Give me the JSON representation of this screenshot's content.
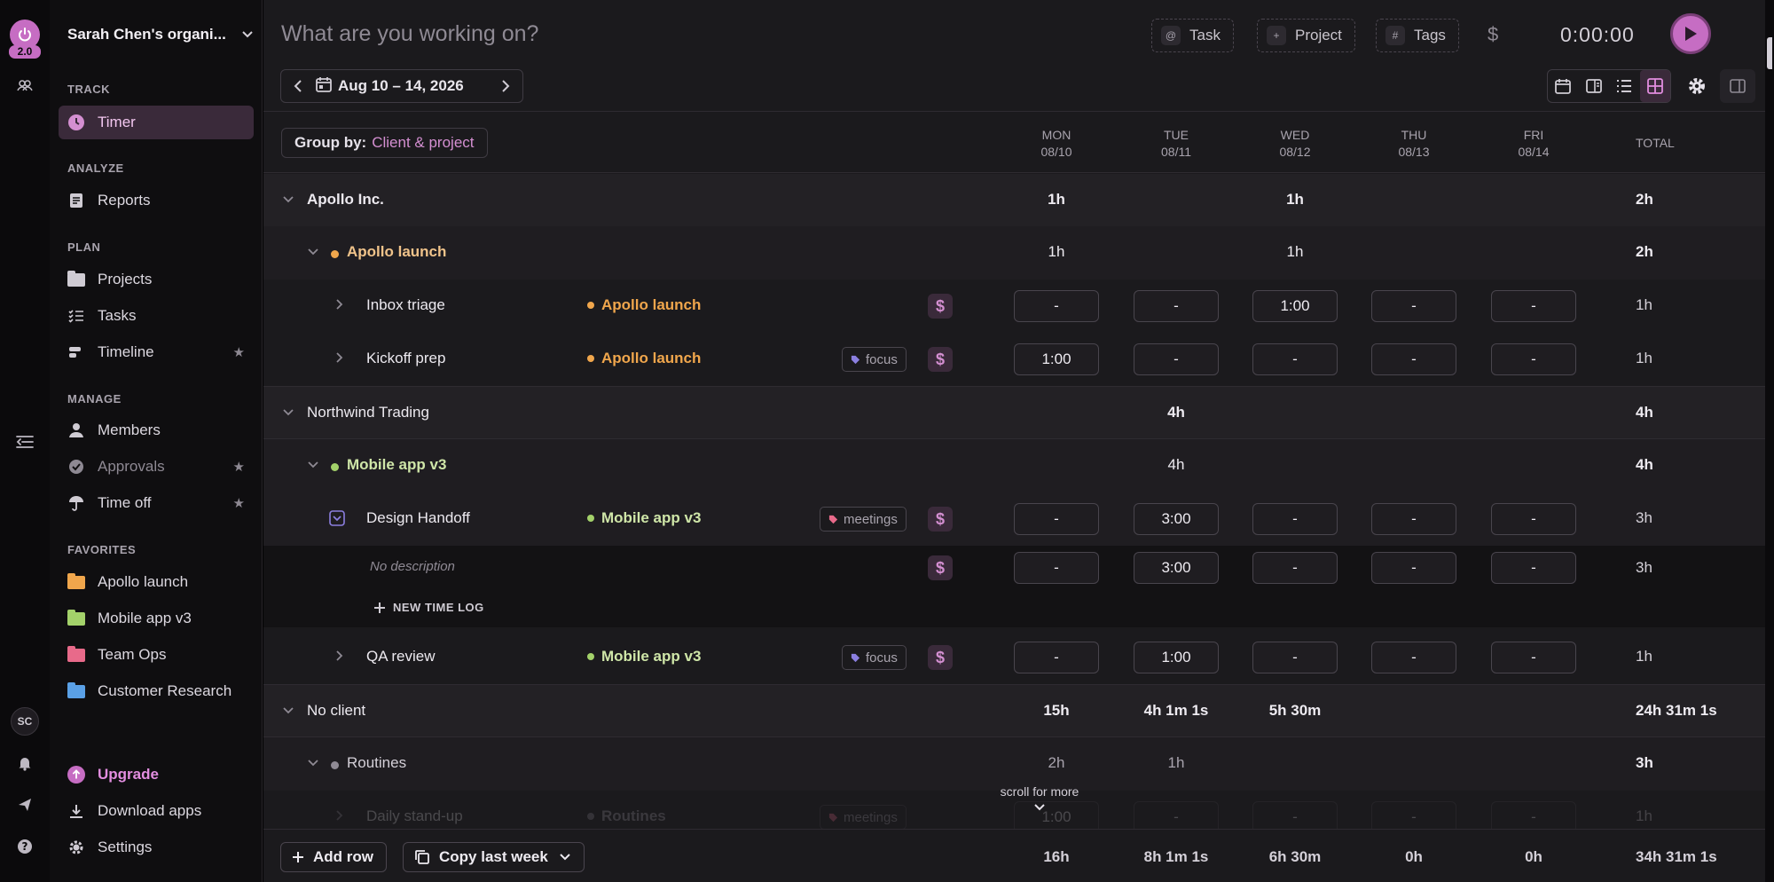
{
  "rail": {
    "version": "2.0",
    "avatar": "SC"
  },
  "sidebar": {
    "org_name": "Sarah Chen's organi...",
    "sections": {
      "track": "TRACK",
      "analyze": "ANALYZE",
      "plan": "PLAN",
      "manage": "MANAGE",
      "favorites": "FAVORITES"
    },
    "items": {
      "timer": "Timer",
      "reports": "Reports",
      "projects": "Projects",
      "tasks": "Tasks",
      "timeline": "Timeline",
      "members": "Members",
      "approvals": "Approvals",
      "time_off": "Time off"
    },
    "favorites": [
      {
        "label": "Apollo launch",
        "color": "#f0a64c"
      },
      {
        "label": "Mobile app v3",
        "color": "#a3d16a"
      },
      {
        "label": "Team Ops",
        "color": "#e86a8a"
      },
      {
        "label": "Customer Research",
        "color": "#5aa0e6"
      }
    ],
    "upgrade": "Upgrade",
    "download_apps": "Download apps",
    "settings": "Settings"
  },
  "topbar": {
    "placeholder": "What are you working on?",
    "task_label": "Task",
    "project_label": "Project",
    "tags_label": "Tags",
    "billable": "$",
    "timer": "0:00:00"
  },
  "week": {
    "range": "Aug 10 – 14, 2026",
    "group_by_label": "Group by:",
    "group_by_value": "Client & project",
    "days": [
      {
        "name": "MON",
        "date": "08/10"
      },
      {
        "name": "TUE",
        "date": "08/11"
      },
      {
        "name": "WED",
        "date": "08/12"
      },
      {
        "name": "THU",
        "date": "08/13"
      },
      {
        "name": "FRI",
        "date": "08/14"
      }
    ],
    "total_label": "TOTAL"
  },
  "rows": {
    "apollo_client": {
      "name": "Apollo Inc.",
      "mon": "1h",
      "wed": "1h",
      "total": "2h"
    },
    "apollo_project": {
      "name": "Apollo launch",
      "mon": "1h",
      "wed": "1h",
      "total": "2h",
      "color": "#f0a64c"
    },
    "inbox_triage": {
      "name": "Inbox triage",
      "project": "Apollo launch",
      "cells": [
        "-",
        "-",
        "1:00",
        "-",
        "-"
      ],
      "total": "1h"
    },
    "kickoff_prep": {
      "name": "Kickoff prep",
      "project": "Apollo launch",
      "tag": "focus",
      "cells": [
        "1:00",
        "-",
        "-",
        "-",
        "-"
      ],
      "total": "1h"
    },
    "northwind_client": {
      "name": "Northwind Trading",
      "tue": "4h",
      "total": "4h"
    },
    "mobile_project": {
      "name": "Mobile app v3",
      "tue": "4h",
      "total": "4h",
      "color": "#a3d16a"
    },
    "design_handoff": {
      "name": "Design Handoff",
      "project": "Mobile app v3",
      "tag": "meetings",
      "cells": [
        "-",
        "3:00",
        "-",
        "-",
        "-"
      ],
      "total": "3h"
    },
    "design_entry": {
      "description": "No description",
      "cells": [
        "-",
        "3:00",
        "-",
        "-",
        "-"
      ],
      "total": "3h"
    },
    "new_time_log": "NEW TIME LOG",
    "qa_review": {
      "name": "QA review",
      "project": "Mobile app v3",
      "tag": "focus",
      "cells": [
        "-",
        "1:00",
        "-",
        "-",
        "-"
      ],
      "total": "1h"
    },
    "no_client": {
      "name": "No client",
      "mon": "15h",
      "tue": "4h 1m 1s",
      "wed": "5h 30m",
      "total": "24h 31m 1s"
    },
    "routines_project": {
      "name": "Routines",
      "mon": "2h",
      "tue": "1h",
      "total": "3h",
      "color": "#8f8a94"
    },
    "daily_standup": {
      "name": "Daily stand-up",
      "project": "Routines",
      "tag": "meetings",
      "cells": [
        "1:00",
        "-",
        "-",
        "-",
        "-"
      ],
      "total": "1h"
    }
  },
  "scroll_hint": "scroll for more",
  "footer": {
    "add_row": "Add row",
    "copy_last_week": "Copy last week",
    "sums": [
      "16h",
      "8h 1m 1s",
      "6h 30m",
      "0h",
      "0h"
    ],
    "grand_total": "34h 31m 1s"
  }
}
